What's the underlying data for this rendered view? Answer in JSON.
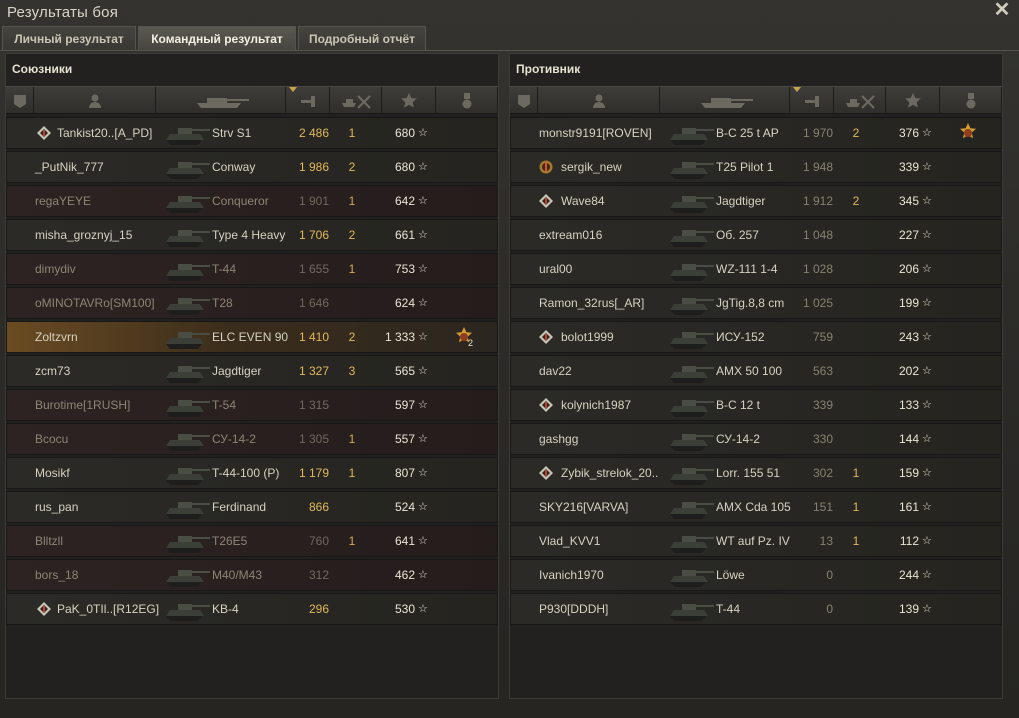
{
  "window": {
    "title": "Результаты боя",
    "close_icon": "close-icon"
  },
  "tabs": [
    {
      "label": "Личный результат",
      "active": false
    },
    {
      "label": "Командный результат",
      "active": true
    },
    {
      "label": "Подробный отчёт",
      "active": false
    }
  ],
  "allies": {
    "title": "Союзники",
    "header_icons": [
      "platoon-icon",
      "player-icon",
      "tank-icon",
      "damage-icon",
      "kills-icon",
      "xp-star-icon",
      "medal-icon"
    ],
    "sorted_column": "damage",
    "rows": [
      {
        "name": "Tankist20..[A_PD]",
        "vehicle": "Strv S1",
        "damage": "2 486",
        "kills": "1",
        "xp": "680",
        "badge": "diamond",
        "dim": false
      },
      {
        "name": "_PutNik_777",
        "vehicle": "Conway",
        "damage": "1 986",
        "kills": "2",
        "xp": "680",
        "badge": "",
        "dim": false
      },
      {
        "name": "regaYEYE",
        "vehicle": "Conqueror",
        "damage": "1 901",
        "kills": "1",
        "xp": "642",
        "badge": "",
        "dim": true
      },
      {
        "name": "misha_groznyj_15",
        "vehicle": "Type 4 Heavy",
        "damage": "1 706",
        "kills": "2",
        "xp": "661",
        "badge": "",
        "dim": false
      },
      {
        "name": "dimydiv",
        "vehicle": "T-44",
        "damage": "1 655",
        "kills": "1",
        "xp": "753",
        "badge": "",
        "dim": true
      },
      {
        "name": "oMINOTAVRo[SM100]",
        "vehicle": "T28",
        "damage": "1 646",
        "kills": "",
        "xp": "624",
        "badge": "",
        "dim": true
      },
      {
        "name": "Zoltzvrn",
        "vehicle": "ELC EVEN 90",
        "damage": "1 410",
        "kills": "2",
        "xp": "1 333",
        "badge": "",
        "dim": false,
        "me": true,
        "medal": "2"
      },
      {
        "name": "zcm73",
        "vehicle": "Jagdtiger",
        "damage": "1 327",
        "kills": "3",
        "xp": "565",
        "badge": "",
        "dim": false
      },
      {
        "name": "Burotime[1RUSH]",
        "vehicle": "T-54",
        "damage": "1 315",
        "kills": "",
        "xp": "597",
        "badge": "",
        "dim": true
      },
      {
        "name": "Bcocu",
        "vehicle": "СУ-14-2",
        "damage": "1 305",
        "kills": "1",
        "xp": "557",
        "badge": "",
        "dim": true
      },
      {
        "name": "Mosikf",
        "vehicle": "T-44-100 (P)",
        "damage": "1 179",
        "kills": "1",
        "xp": "807",
        "badge": "",
        "dim": false
      },
      {
        "name": "rus_pan",
        "vehicle": "Ferdinand",
        "damage": "866",
        "kills": "",
        "xp": "524",
        "badge": "",
        "dim": false
      },
      {
        "name": "Blltzll",
        "vehicle": "T26E5",
        "damage": "760",
        "kills": "1",
        "xp": "641",
        "badge": "",
        "dim": true
      },
      {
        "name": "bors_18",
        "vehicle": "M40/M43",
        "damage": "312",
        "kills": "",
        "xp": "462",
        "badge": "",
        "dim": true
      },
      {
        "name": "PaK_0TIl..[R12EG]",
        "vehicle": "KB-4",
        "damage": "296",
        "kills": "",
        "xp": "530",
        "badge": "diamond",
        "dim": false
      }
    ]
  },
  "enemies": {
    "title": "Противник",
    "header_icons": [
      "platoon-icon",
      "player-icon",
      "tank-icon",
      "damage-icon",
      "kills-icon",
      "xp-star-icon",
      "medal-icon"
    ],
    "sorted_column": "damage",
    "rows": [
      {
        "name": "monstr9191[ROVEN]",
        "vehicle": "B-C 25 t AP",
        "damage": "1 970",
        "kills": "2",
        "xp": "376",
        "badge": "",
        "medal": ""
      },
      {
        "name": "sergik_new",
        "vehicle": "T25 Pilot 1",
        "damage": "1 948",
        "kills": "",
        "xp": "339",
        "badge": "circle"
      },
      {
        "name": "Wave84",
        "vehicle": "Jagdtiger",
        "damage": "1 912",
        "kills": "2",
        "xp": "345",
        "badge": "diamond"
      },
      {
        "name": "extream016",
        "vehicle": "Об. 257",
        "damage": "1 048",
        "kills": "",
        "xp": "227",
        "badge": ""
      },
      {
        "name": "ural00",
        "vehicle": "WZ-111 1-4",
        "damage": "1 028",
        "kills": "",
        "xp": "206",
        "badge": ""
      },
      {
        "name": "Ramon_32rus[_AR]",
        "vehicle": "JgTig.8,8 cm",
        "damage": "1 025",
        "kills": "",
        "xp": "199",
        "badge": ""
      },
      {
        "name": "bolot1999",
        "vehicle": "ИСУ-152",
        "damage": "759",
        "kills": "",
        "xp": "243",
        "badge": "diamond"
      },
      {
        "name": "dav22",
        "vehicle": "AMX 50 100",
        "damage": "563",
        "kills": "",
        "xp": "202",
        "badge": ""
      },
      {
        "name": "kolynich1987",
        "vehicle": "B-C 12 t",
        "damage": "339",
        "kills": "",
        "xp": "133",
        "badge": "diamond"
      },
      {
        "name": "gashgg",
        "vehicle": "СУ-14-2",
        "damage": "330",
        "kills": "",
        "xp": "144",
        "badge": ""
      },
      {
        "name": "Zybik_strelok_20..",
        "vehicle": "Lorr. 155 51",
        "damage": "302",
        "kills": "1",
        "xp": "159",
        "badge": "diamond"
      },
      {
        "name": "SKY216[VARVA]",
        "vehicle": "AMX Cda 105",
        "damage": "151",
        "kills": "1",
        "xp": "161",
        "badge": ""
      },
      {
        "name": "Vlad_KVV1",
        "vehicle": "WT auf Pz. IV",
        "damage": "13",
        "kills": "1",
        "xp": "112",
        "badge": ""
      },
      {
        "name": "Ivanich1970",
        "vehicle": "Löwe",
        "damage": "0",
        "kills": "",
        "xp": "244",
        "badge": ""
      },
      {
        "name": "P930[DDDH]",
        "vehicle": "T-44",
        "damage": "0",
        "kills": "",
        "xp": "139",
        "badge": ""
      }
    ]
  },
  "colors": {
    "accent": "#e0b85a",
    "highlight_row": "#6a4b23",
    "dim_row": "#2d2322"
  }
}
